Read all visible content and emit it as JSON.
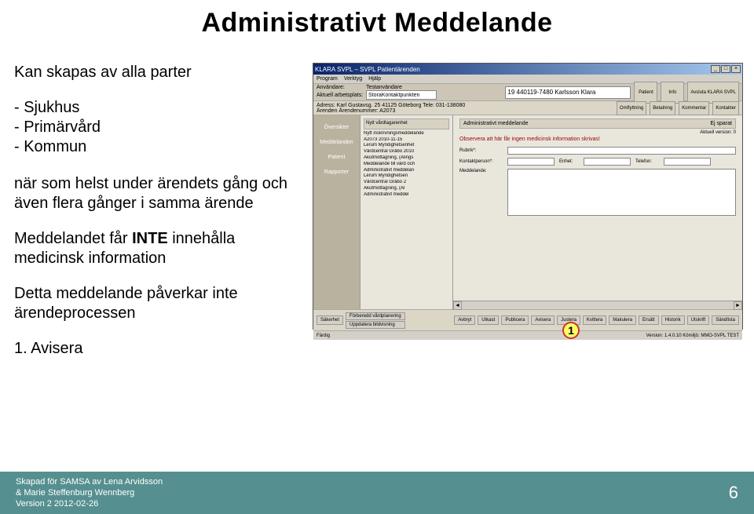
{
  "slide": {
    "title": "Administrativt Meddelande",
    "intro": "Kan skapas av alla parter",
    "bullets": [
      "Sjukhus",
      "Primärvård",
      "Kommun"
    ],
    "para1": "när som helst under ärendets gång och även flera gånger i samma ärende",
    "para2_pre": "Meddelandet får ",
    "para2_strong": "INTE",
    "para2_post": " innehålla medicinsk information",
    "para3": "Detta meddelande påverkar inte ärendeprocessen",
    "step1": "1.  Avisera"
  },
  "app": {
    "title": "KLARA SVPL – SVPL Patientärenden",
    "close": "×",
    "min": "_",
    "max": "□",
    "menus": [
      "Program",
      "Verktyg",
      "Hjälp"
    ],
    "user_label": "Användare:",
    "user_value": "Testanvändare",
    "workplace_label": "Aktuell arbetsplats:",
    "workplace_value": "StoraKontaktpunkten",
    "patient_value": "19 440119-7480 Karlsson Klara",
    "btn_patient": "Patient",
    "btn_info": "Info",
    "btn_close_app": "Avsluta KLARA SVPL",
    "row2_label_addr": "Adress: Karl Gustavsg. 25 41125 Göteborg Tele: 031-138080",
    "row2_label_case": "Ärenden   Ärendenummer: A2073",
    "btn_omflyttning": "Omflyttning",
    "btn_betalning": "Betalning",
    "btn_kommentar": "Kommentar",
    "btn_kontakter": "Kontakter",
    "sidebar": [
      "Översikter",
      "Meddelanden",
      "Patient",
      "Rapporter"
    ],
    "tree_head": "Nytt vårdtagarenhet",
    "tree": [
      "Nytt inskrivningsmeddelande",
      "A2073 2010-11-15",
      "Lerum Myndighetsenhet",
      "Vårdcentral Gråbo 2010",
      "Akutmottagning, (Alings",
      "Meddelande till vård och",
      "Administrativt meddelan",
      "Lerum Myndighetsen",
      "Vårdcentral Gråbo 2",
      "Akutmottagning, (Al",
      "Administrativt meddel"
    ],
    "form_title": "Administrativt meddelande",
    "form_status": "Ej sparat",
    "form_version": "Aktuell version: 0",
    "form_warning": "Observera att här får ingen medicinsk information skrivas!",
    "f_rubrik": "Rubrik*:",
    "f_kontakt": "Kontaktperson*:",
    "f_enhet": "Enhet:",
    "f_telefon": "Telefon:",
    "f_meddelande": "Meddelande:",
    "bottombar_left": [
      "Säkerhet",
      "Förberedd vårdplanering",
      "Uppdatera bildvisning"
    ],
    "bottombar_right": [
      "Avbryt",
      "Utkast",
      "Publicera",
      "Avisera",
      "Justera",
      "Kvittera",
      "Makulera",
      "Ersätt",
      "Historik",
      "Utskrift",
      "Sändlista"
    ],
    "status_left": "Färdig",
    "status_right": "Version: 1.4.0.10   Kömiljö: MMO-SVPL TEST"
  },
  "callout": "1",
  "footer": {
    "line1": "Skapad för SAMSA av Lena Arvidsson",
    "line2": "& Marie Steffenburg Wennberg",
    "line3": "Version 2  2012-02-26",
    "page": "6"
  }
}
